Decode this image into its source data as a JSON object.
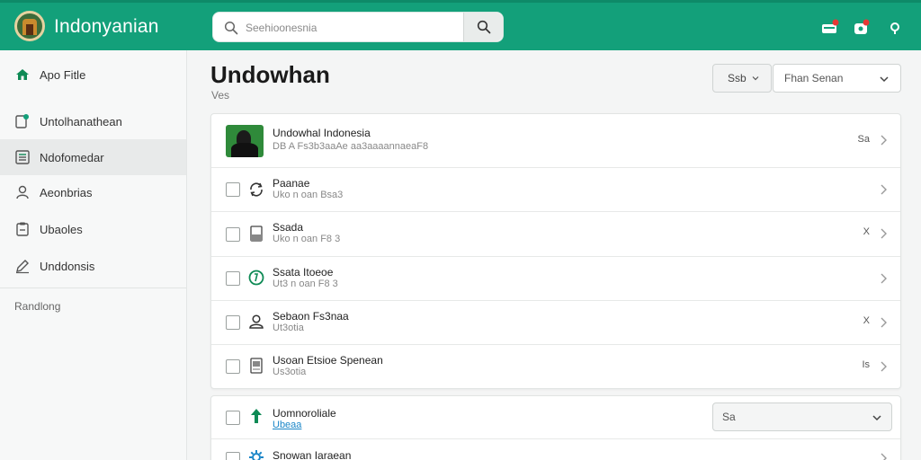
{
  "app": {
    "title": "Indonyanian"
  },
  "search": {
    "placeholder": "Seehioonesnia"
  },
  "sidebar": {
    "items": [
      {
        "label": "Apo Fitle",
        "icon": "home-icon"
      },
      {
        "label": "Untolhanathean",
        "icon": "document-edit-icon"
      },
      {
        "label": "Ndofomedar",
        "icon": "list-icon"
      },
      {
        "label": "Aeonbrias",
        "icon": "user-icon"
      },
      {
        "label": "Ubaoles",
        "icon": "clipboard-icon"
      },
      {
        "label": "Unddonsis",
        "icon": "edit-icon"
      }
    ],
    "section_label": "Randlong"
  },
  "main": {
    "title": "Undowhan",
    "subtitle": "Ves",
    "sort_label": "Ssb",
    "filter_label": "Fhan Senan"
  },
  "list": {
    "featured": {
      "title": "Undowhal Indonesia",
      "subtitle": "DB A Fs3b3aaAe aa3aaaannaeaF8",
      "meta": "Sa"
    },
    "rows": [
      {
        "title": "Paanae",
        "subtitle": "Uko n oan Bsa3",
        "meta": "",
        "icon": "refresh-icon"
      },
      {
        "title": "Ssada",
        "subtitle": "Uko n oan F8 3",
        "meta": "X",
        "icon": "document-icon"
      },
      {
        "title": "Ssata  Itoeoe",
        "subtitle": "Ut3 n oan F8 3",
        "meta": "",
        "icon": "clock-icon"
      },
      {
        "title": "Sebaon Fs3naa",
        "subtitle": "Ut3otia",
        "meta": "X",
        "icon": "person-icon"
      },
      {
        "title": "Usoan Etsioe Spenean",
        "subtitle": "Us3otia",
        "meta": "Is",
        "icon": "file-icon"
      }
    ]
  },
  "list2": {
    "rows": [
      {
        "title": "Uomnoroliale",
        "subtitle": "Ubeaa",
        "select_label": "Sa",
        "icon": "arrow-up-icon"
      },
      {
        "title": "Snowan Iaraean",
        "subtitle": "",
        "icon": "gear-icon"
      }
    ]
  },
  "colors": {
    "primary": "#13a07a",
    "link": "#1a86c8",
    "accent_green": "#0e8a55"
  }
}
